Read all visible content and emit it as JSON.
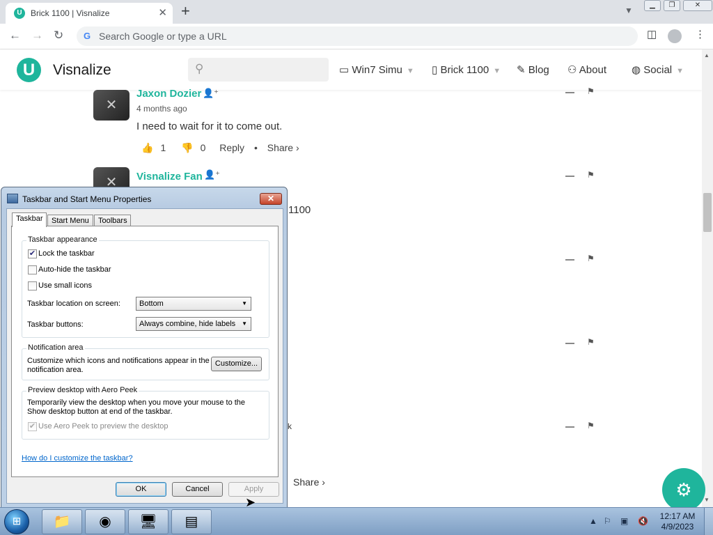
{
  "browser": {
    "tab_title": "Brick 1100 | Visnalize",
    "tab_favicon": "U",
    "tab_close": "✕",
    "new_tab": "+",
    "omnibox_placeholder": "Search Google or type a URL",
    "google_icon": "G"
  },
  "site": {
    "logo_letter": "U",
    "brand": "Visnalize",
    "menu": [
      {
        "label": "Win7 Simu",
        "icon": "laptop-icon",
        "dropdown": true
      },
      {
        "label": "Brick 1100",
        "icon": "phone-icon",
        "dropdown": true
      },
      {
        "label": "Blog",
        "icon": "edit-icon",
        "dropdown": false
      },
      {
        "label": "About",
        "icon": "people-icon",
        "dropdown": false
      },
      {
        "label": "Social",
        "icon": "globe-icon",
        "dropdown": true
      }
    ]
  },
  "comments": [
    {
      "author": "Jaxon Dozier",
      "time": "4 months ago",
      "text": "I need to wait for it to come out.",
      "likes": "1",
      "dislikes": "0",
      "reply": "Reply",
      "share": "Share ›"
    },
    {
      "author": "Visnalize Fan",
      "partial_text": "1100"
    }
  ],
  "page_misc": {
    "stray_share": "Share ›",
    "stray_k": "k"
  },
  "dialog": {
    "title": "Taskbar and Start Menu Properties",
    "tabs": [
      "Taskbar",
      "Start Menu",
      "Toolbars"
    ],
    "active_tab": "Taskbar",
    "appearance": {
      "legend": "Taskbar appearance",
      "lock_label": "Lock the taskbar",
      "lock_checked": true,
      "autohide_label": "Auto-hide the taskbar",
      "autohide_checked": false,
      "small_icons_label": "Use small icons",
      "small_icons_checked": false,
      "location_label": "Taskbar location on screen:",
      "location_value": "Bottom",
      "buttons_label": "Taskbar buttons:",
      "buttons_value": "Always combine, hide labels"
    },
    "notification": {
      "legend": "Notification area",
      "text_line1": "Customize which icons and notifications appear in the",
      "text_line2": "notification area.",
      "button": "Customize..."
    },
    "aero": {
      "legend": "Preview desktop with Aero Peek",
      "text_line1": "Temporarily view the desktop when you move your mouse to the",
      "text_line2": "Show desktop button at end of the taskbar.",
      "checkbox_label": "Use Aero Peek to preview the desktop",
      "checked": true,
      "disabled": true
    },
    "help_link": "How do I customize the taskbar?",
    "buttons": {
      "ok": "OK",
      "cancel": "Cancel",
      "apply": "Apply"
    }
  },
  "taskbar": {
    "time": "12:17 AM",
    "date": "4/9/2023"
  },
  "colors": {
    "accent": "#1fb59c",
    "link": "#0066cc"
  }
}
